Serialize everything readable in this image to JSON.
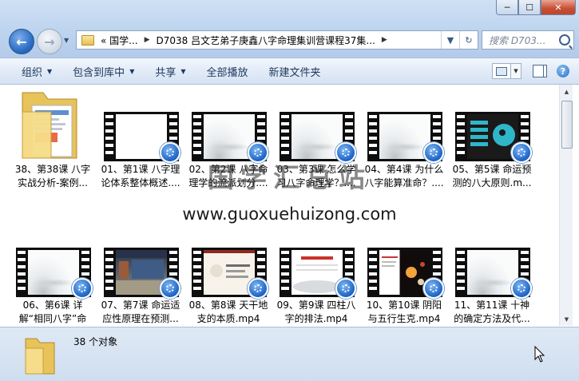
{
  "window": {
    "buttons": [
      "─",
      "☐",
      "✕"
    ]
  },
  "address": {
    "crumb1": "«  国学...",
    "crumb2": "D7038 吕文艺弟子庚鑫八字命理集训营课程37集...",
    "tail_icons": [
      "chevron-down-icon",
      "refresh-icon"
    ]
  },
  "search": {
    "placeholder": "搜索 D703..."
  },
  "toolbar": {
    "organize": "组织",
    "include_library": "包含到库中",
    "share": "共享",
    "play_all": "全部播放",
    "new_folder": "新建文件夹"
  },
  "items": [
    {
      "label": "38、第38课 八字实战分析-案例...",
      "kind": "folder"
    },
    {
      "label": "01、第1课 八字理论体系整体概述....",
      "kind": "video",
      "thumb": "white"
    },
    {
      "label": "02、第2课 八字命理学的流派划分....",
      "kind": "video",
      "thumb": "ink"
    },
    {
      "label": "03、第3课 怎么学习八字命理学？....",
      "kind": "video",
      "thumb": "ink"
    },
    {
      "label": "04、第4课 为什么八字能算准命？....",
      "kind": "video",
      "thumb": "ink"
    },
    {
      "label": "05、第5课 命运预测的八大原则.m...",
      "kind": "video",
      "thumb": "dark"
    },
    {
      "label": "06、第6课 详解“相同八字”命运...",
      "kind": "video",
      "thumb": "ink"
    },
    {
      "label": "07、第7课 命运适应性原理在预测...",
      "kind": "video",
      "thumb": "hall"
    },
    {
      "label": "08、第8课 天干地支的本质.mp4",
      "kind": "video",
      "thumb": "paper"
    },
    {
      "label": "09、第9课 四柱八字的排法.mp4",
      "kind": "video",
      "thumb": "redtitle"
    },
    {
      "label": "10、第10课 阴阳与五行生克.mp4",
      "kind": "video",
      "thumb": "space"
    },
    {
      "label": "11、第11课 十神的确定方法及代...",
      "kind": "video",
      "thumb": "ink"
    }
  ],
  "status": {
    "count": "38 个对象"
  },
  "watermark": {
    "cn": "国学汇总站",
    "url": "www.guoxuehuizong.com"
  },
  "colors": {
    "accent": "#1b62c4",
    "chrome": "#bcd3ee"
  }
}
